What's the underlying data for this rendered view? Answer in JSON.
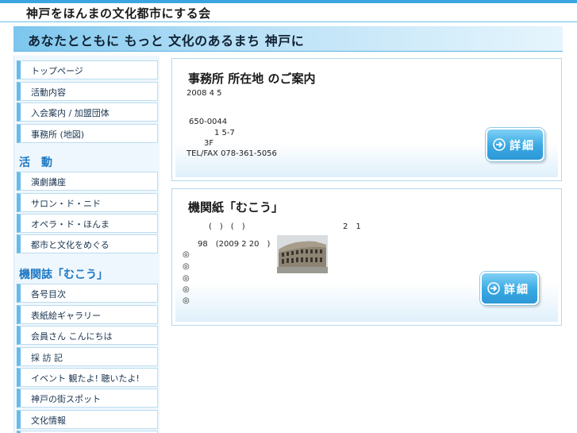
{
  "site": {
    "title": "神戸をほんまの文化都市にする会",
    "tagline": "あなたとともに もっと 文化のあるまち 神戸に"
  },
  "sidebar": {
    "main_items": [
      {
        "label": "トップページ"
      },
      {
        "label": "活動内容"
      },
      {
        "label": "入会案内 / 加盟団体"
      },
      {
        "label": "事務所 (地図)"
      }
    ],
    "activities_heading": "活　動",
    "activities": [
      {
        "label": "演劇講座"
      },
      {
        "label": "サロン・ド・ニド"
      },
      {
        "label": "オペラ・ド・ほんま"
      },
      {
        "label": "都市と文化をめぐる"
      }
    ],
    "magazine_heading": "機関誌「むこう」",
    "magazine_items": [
      {
        "label": "各号目次"
      },
      {
        "label": "表紙絵ギャラリー"
      },
      {
        "label": "会員さん こんにちは"
      },
      {
        "label": "採 訪 記"
      },
      {
        "label": "イベント 観たよ! 聴いたよ!"
      },
      {
        "label": "神戸の街スポット"
      },
      {
        "label": "文化情報"
      }
    ]
  },
  "office": {
    "title": "事務所 所在地 のご案内",
    "date": "2008 4 5",
    "postal": "650-0044",
    "address": "1 5-7",
    "floor": "3F",
    "tel": "TEL/FAX 078-361-5056",
    "detail_label": "詳細"
  },
  "magazine": {
    "title": "機関紙「むこう」",
    "line1": "(　)　(　)",
    "line1_right": "2　1",
    "line2": "98　(2009 2 20　)",
    "bullets": [
      "◎",
      "◎",
      "◎",
      "◎",
      "◎"
    ],
    "detail_label": "詳細"
  },
  "colors": {
    "accent": "#3aa6e0",
    "heading_blue": "#1d78c4",
    "button_blue": "#39a9e3"
  },
  "icons": {
    "detail_arrow": "arrow-right-circle-icon",
    "photo": "colosseum-photo"
  }
}
